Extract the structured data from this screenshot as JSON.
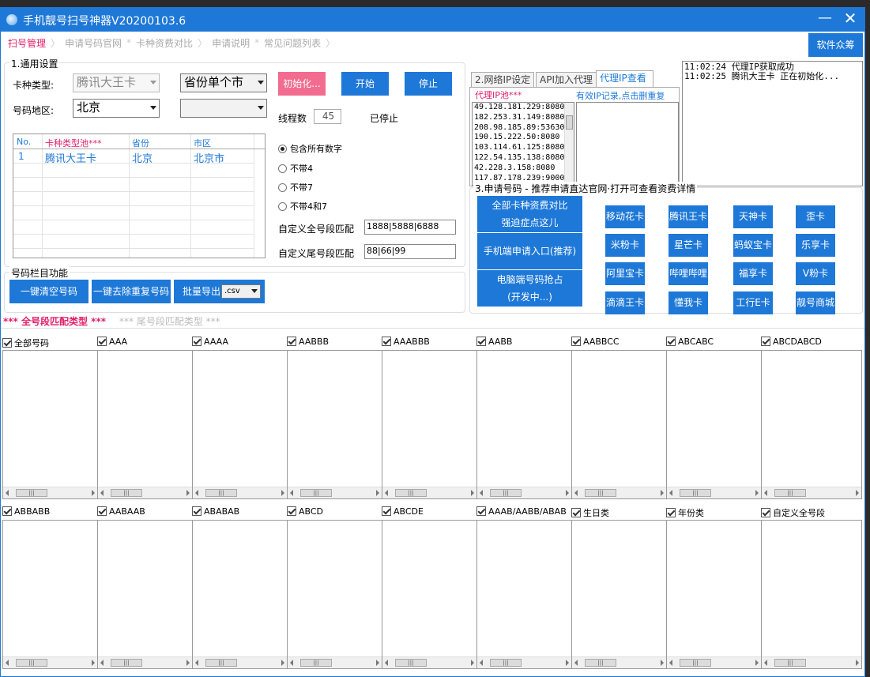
{
  "window": {
    "title": "手机靓号扫号神器V20200103.6",
    "minimize": "—",
    "close": "✕"
  },
  "nav": {
    "tabs": [
      "扫号管理",
      "申请号码官网",
      "卡种资费对比",
      "申请说明",
      "常见问题列表"
    ],
    "separators": [
      "*",
      "*"
    ],
    "donate": "软件众筹"
  },
  "general": {
    "title": "1.通用设置",
    "card_type_label": "卡种类型:",
    "card_type_value": "腾讯大王卡",
    "province_mode": "省份单个市",
    "region_label": "号码地区:",
    "region_value": "北京",
    "city_value": "",
    "init_button": "初始化...",
    "start_button": "开始",
    "stop_button": "停止",
    "threads_label": "线程数",
    "threads_value": "45",
    "status": "已停止",
    "table": {
      "headers": [
        "No.",
        "卡种类型池***",
        "省份",
        "市区"
      ],
      "rows": [
        [
          "1",
          "腾讯大王卡",
          "北京",
          "北京市"
        ]
      ]
    },
    "radios": [
      "包含所有数字",
      "不带4",
      "不带7",
      "不带4和7"
    ],
    "custom_full_label": "自定义全号段匹配",
    "custom_full_value": "1888|5888|6888",
    "custom_tail_label": "自定义尾号段匹配",
    "custom_tail_value": "88|66|99"
  },
  "numbar": {
    "title": "号码栏目功能",
    "clear_button": "一键清空号码",
    "dedupe_button": "一键去除重复号码",
    "export_button": "批量导出",
    "export_format": ".csv"
  },
  "ip": {
    "tabs": [
      "2.网络IP设定",
      "API加入代理",
      "代理IP查看"
    ],
    "pool_label": "代理IP池***",
    "pool": [
      "49.128.181.229:8080",
      "182.253.31.149:8080",
      "208.98.185.89:53630",
      "190.15.222.50:8080",
      "103.114.61.125:8080",
      "122.54.135.138:8080",
      "42.228.3.158:8080",
      "117.87.178.239:9000"
    ],
    "valid_label": "有效IP记录,点击删重复"
  },
  "log": [
    "11:02:24 代理IP获取成功",
    "11:02:25 腾讯大王卡 正在初始化..."
  ],
  "apply": {
    "title": "3.申请号码 - 推荐申请直达官网·打开可查看资费详情",
    "big1": [
      "全部卡种资费对比",
      "强迫症点这儿"
    ],
    "big2": "手机端申请入口(推荐)",
    "big3": [
      "电脑端号码抢占",
      "(开发中...)"
    ],
    "cards": [
      "移动花卡",
      "腾讯王卡",
      "天神卡",
      "歪卡",
      "米粉卡",
      "星芒卡",
      "蚂蚁宝卡",
      "乐享卡",
      "阿里宝卡",
      "哔哩哔哩",
      "福享卡",
      "V粉卡",
      "滴滴王卡",
      "懂我卡",
      "工行E卡",
      "靓号商城"
    ]
  },
  "match_tabs": {
    "active": "*** 全号段匹配类型 ***",
    "inactive": "*** 尾号段匹配类型 ***"
  },
  "row1": [
    "全部号码",
    "AAA",
    "AAAA",
    "AABBB",
    "AAABBB",
    "AABB",
    "AABBCC",
    "ABCABC",
    "ABCDABCD"
  ],
  "row2": [
    "ABBABB",
    "AABAAB",
    "ABABAB",
    "ABCD",
    "ABCDE",
    "AAAB/AABB/ABAB",
    "生日类",
    "年份类",
    "自定义全号段"
  ],
  "colors": {
    "accent": "#1e78d7",
    "pink": "#e21f6a"
  }
}
